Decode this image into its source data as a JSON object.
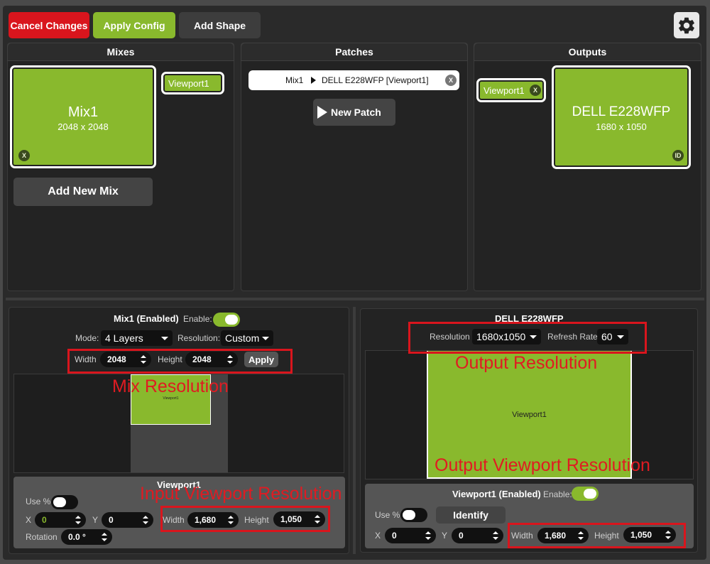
{
  "toolbar": {
    "cancel_label": "Cancel Changes",
    "apply_label": "Apply Config",
    "add_shape_label": "Add Shape"
  },
  "mixes": {
    "title": "Mixes",
    "mix_name": "Mix1",
    "mix_size": "2048 x 2048",
    "close_label": "X",
    "viewport_tag": "Viewport1",
    "add_mix_label": "Add New Mix"
  },
  "patches": {
    "title": "Patches",
    "patch_source": "Mix1",
    "patch_target": "DELL E228WFP [Viewport1]",
    "close_label": "X",
    "new_patch_label": "New Patch"
  },
  "outputs": {
    "title": "Outputs",
    "viewport_tag": "Viewport1",
    "tag_close": "X",
    "output_name": "DELL E228WFP",
    "output_size": "1680 x 1050",
    "id_label": "ID"
  },
  "mix_detail": {
    "title": "Mix1 (Enabled)",
    "enable_label": "Enable:",
    "mode_label": "Mode:",
    "mode_value": "4 Layers",
    "resolution_label": "Resolution:",
    "resolution_value": "Custom",
    "width_label": "Width",
    "width_value": "2048",
    "height_label": "Height",
    "height_value": "2048",
    "apply_label": "Apply",
    "preview_viewport": "Viewport1",
    "annotation": "Mix Resolution"
  },
  "input_viewport": {
    "title": "Viewport1",
    "use_pct_label": "Use %",
    "x_label": "X",
    "x_value": "0",
    "y_label": "Y",
    "y_value": "0",
    "width_label": "Width",
    "width_value": "1,680",
    "height_label": "Height",
    "height_value": "1,050",
    "rotation_label": "Rotation",
    "rotation_value": "0.0 °",
    "annotation": "Input Viewport Resolution"
  },
  "output_detail": {
    "title": "DELL E228WFP",
    "resolution_label": "Resolution",
    "resolution_value": "1680x1050",
    "refresh_label": "Refresh Rate",
    "refresh_value": "60",
    "preview_viewport": "Viewport1",
    "annotation_resolution": "Output Resolution",
    "annotation_viewport": "Output Viewport Resolution"
  },
  "output_viewport": {
    "title": "Viewport1 (Enabled)",
    "enable_label": "Enable:",
    "use_pct_label": "Use %",
    "identify_label": "Identify",
    "x_label": "X",
    "x_value": "0",
    "y_label": "Y",
    "y_value": "0",
    "width_label": "Width",
    "width_value": "1,680",
    "height_label": "Height",
    "height_value": "1,050"
  },
  "colors": {
    "accent_green": "#89b92d",
    "cancel_red": "#d9151d",
    "annotation_red": "#e01b22"
  },
  "icons": {
    "settings": "gear-icon",
    "play": "play-icon",
    "arrow": "arrow-right-icon"
  }
}
